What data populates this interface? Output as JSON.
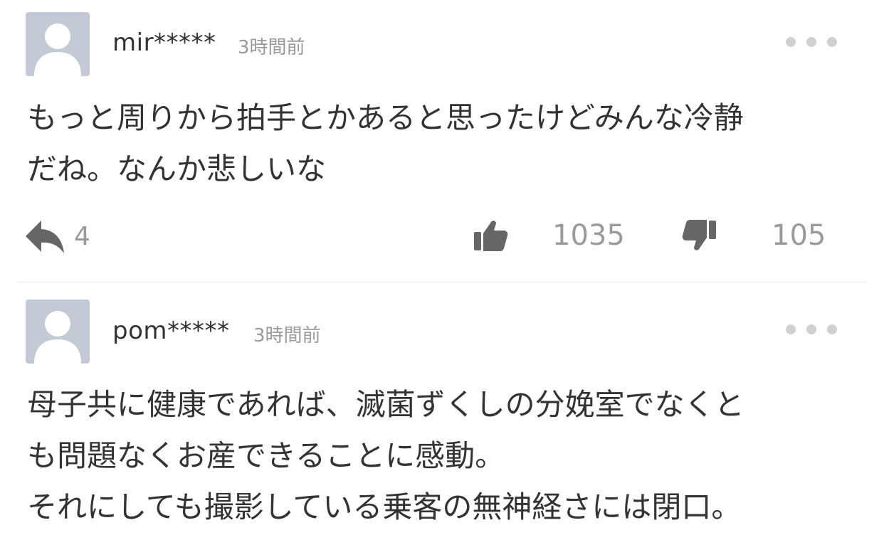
{
  "colors": {
    "avatar_bg": "#c3cad6",
    "text": "#333333",
    "meta_text": "#9a9a9a",
    "icon": "#666666",
    "more_dots": "#d0d0d0",
    "divider": "#e6e6e6"
  },
  "comments": [
    {
      "username": "mir*****",
      "timestamp": "3時間前",
      "avatar_icon": "default-user-icon",
      "more_icon": "more-dots-icon",
      "body_lines": [
        "もっと周りから拍手とかあると思ったけどみんな冷静",
        "だね。なんか悲しいな"
      ],
      "reply_icon": "reply-arrow-icon",
      "reply_count": "4",
      "like_icon": "thumbs-up-icon",
      "like_count": "1035",
      "dislike_icon": "thumbs-down-icon",
      "dislike_count": "105"
    },
    {
      "username": "pom*****",
      "timestamp": "3時間前",
      "avatar_icon": "default-user-icon",
      "more_icon": "more-dots-icon",
      "body_lines": [
        "母子共に健康であれば、滅菌ずくしの分娩室でなくと",
        "も問題なくお産できることに感動。",
        "それにしても撮影している乗客の無神経さには閉口。"
      ]
    }
  ]
}
